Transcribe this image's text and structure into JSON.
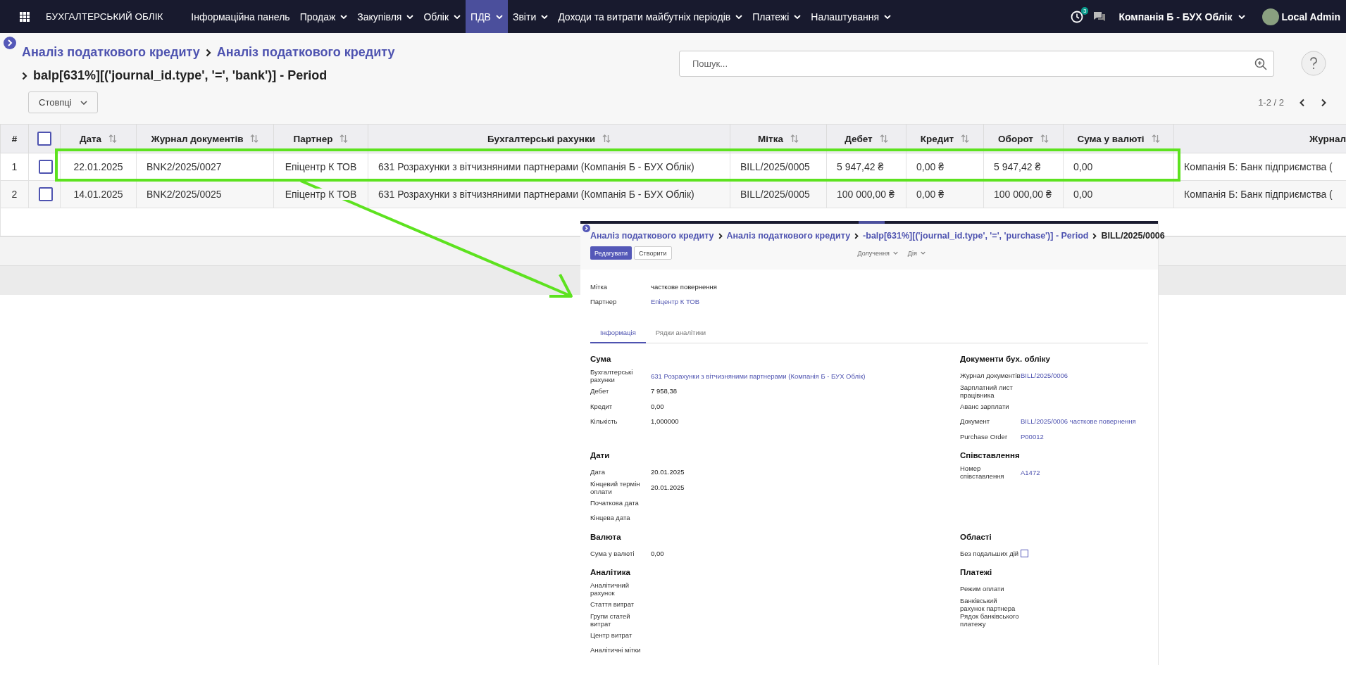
{
  "navbar": {
    "app_name": "БУХГАЛТЕРСЬКИЙ ОБЛІК",
    "menu": [
      {
        "label": "Інформаційна панель",
        "dropdown": false,
        "selected": false
      },
      {
        "label": "Продаж",
        "dropdown": true,
        "selected": false
      },
      {
        "label": "Закупівля",
        "dropdown": true,
        "selected": false
      },
      {
        "label": "Облік",
        "dropdown": true,
        "selected": false
      },
      {
        "label": "ПДВ",
        "dropdown": true,
        "selected": true
      },
      {
        "label": "Звіти",
        "dropdown": true,
        "selected": false
      },
      {
        "label": "Доходи та витрати майбутніх періодів",
        "dropdown": true,
        "selected": false
      },
      {
        "label": "Платежі",
        "dropdown": true,
        "selected": false
      },
      {
        "label": "Налаштування",
        "dropdown": true,
        "selected": false
      }
    ],
    "activity_count": "3",
    "company": "Компанія Б - БУХ Облік",
    "user": "Local Admin"
  },
  "breadcrumbs": [
    {
      "label": "Аналіз податкового кредиту",
      "link": true
    },
    {
      "label": "Аналіз податкового кредиту",
      "link": true
    },
    {
      "label": "balp[631%][('journal_id.type', '=', 'bank')] - Period",
      "link": false
    }
  ],
  "search": {
    "placeholder": "Пошук..."
  },
  "columns_button": "Стовпці",
  "pager": "1-2 / 2",
  "table": {
    "number_header": "#",
    "select_all": {
      "checked": false
    },
    "columns": [
      {
        "label": "Дата",
        "sortable": true
      },
      {
        "label": "Журнал документів",
        "sortable": true
      },
      {
        "label": "Партнер",
        "sortable": true
      },
      {
        "label": "Бухгалтерські рахунки",
        "sortable": true
      },
      {
        "label": "Мітка",
        "sortable": true
      },
      {
        "label": "Дебет",
        "sortable": true
      },
      {
        "label": "Кредит",
        "sortable": true
      },
      {
        "label": "Оборот",
        "sortable": true
      },
      {
        "label": "Сума у валюті",
        "sortable": true
      },
      {
        "label": "Журнал",
        "sortable": false
      }
    ],
    "rows": [
      {
        "number": "1",
        "checked": false,
        "cells": [
          "22.01.2025",
          "BNK2/2025/0027",
          "Епіцентр К ТОВ",
          "631 Розрахунки з вітчизняними партнерами (Компанія Б - БУХ Облік)",
          "BILL/2025/0005",
          "5 947,42 ₴",
          "0,00 ₴",
          "5 947,42 ₴",
          "0,00",
          "Компанія Б: Банк підприємства ("
        ]
      },
      {
        "number": "2",
        "checked": false,
        "cells": [
          "14.01.2025",
          "BNK2/2025/0025",
          "Епіцентр К ТОВ",
          "631 Розрахунки з вітчизняними партнерами (Компанія Б - БУХ Облік)",
          "BILL/2025/0005",
          "100 000,00 ₴",
          "0,00 ₴",
          "100 000,00 ₴",
          "0,00",
          "Компанія Б: Банк підприємства ("
        ]
      }
    ]
  },
  "annotation": {
    "frame": true,
    "arrow": true
  },
  "detail_window": {
    "breadcrumbs": [
      {
        "label": "Аналіз податкового кредиту",
        "link": true
      },
      {
        "label": "Аналіз податкового кредиту",
        "link": true
      },
      {
        "label": "-balp[631%][('journal_id.type', '=', 'purchase')] - Period",
        "link": true
      },
      {
        "label": "BILL/2025/0006",
        "link": false
      }
    ],
    "buttons": [
      {
        "label": "Редагувати",
        "kind": "primary"
      },
      {
        "label": "Створити",
        "kind": "secondary"
      }
    ],
    "menus": [
      "Долучення",
      "Дія"
    ],
    "header_fields": [
      {
        "label": "Мітка",
        "value": "часткове повернення",
        "kind": "text"
      },
      {
        "label": "Партнер",
        "value": "Епіцентр К ТОВ",
        "kind": "link"
      }
    ],
    "tabs": [
      {
        "label": "Інформація",
        "selected": true
      },
      {
        "label": "Рядки аналітики",
        "selected": false
      }
    ],
    "section_rows": [
      {
        "left": {
          "title": "Сума",
          "fields": [
            {
              "label": "Бухгалтерські рахунки",
              "value": "631 Розрахунки з вітчизняними партнерами (Компанія Б - БУХ Облік)",
              "kind": "link"
            },
            {
              "label": "Дебет",
              "value": "7 958,38",
              "kind": "text"
            },
            {
              "label": "Кредит",
              "value": "0,00",
              "kind": "text"
            },
            {
              "label": "Кількість",
              "value": "1,000000",
              "kind": "text"
            }
          ]
        },
        "right": {
          "title": "Документи бух. обліку",
          "fields": [
            {
              "label": "Журнал документів",
              "value": "BILL/2025/0006",
              "kind": "link"
            },
            {
              "label": "Зарплатний лист працівника",
              "kind": "text"
            },
            {
              "label": "Аванс зарплати",
              "kind": "text"
            },
            {
              "label": "Документ",
              "value": "BILL/2025/0006 часткове повернення",
              "kind": "link"
            },
            {
              "label": "Purchase Order",
              "value": "P00012",
              "kind": "link"
            }
          ]
        }
      },
      {
        "left": {
          "title": "Дати",
          "fields": [
            {
              "label": "Дата",
              "value": "20.01.2025",
              "kind": "text"
            },
            {
              "label": "Кінцевий термін оплати",
              "value": "20.01.2025",
              "kind": "text"
            },
            {
              "label": "Початкова дата",
              "kind": "text"
            },
            {
              "label": "Кінцева дата",
              "kind": "text"
            }
          ]
        },
        "right": {
          "title": "Співставлення",
          "fields": [
            {
              "label": "Номер співставлення",
              "value": "A1472",
              "kind": "link"
            }
          ]
        }
      },
      {
        "left": {
          "title": "Валюта",
          "fields": [
            {
              "label": "Сума у валюті",
              "value": "0,00",
              "kind": "text"
            }
          ]
        },
        "right": {
          "title": "Області",
          "fields": [
            {
              "label": "Без подальших дій",
              "kind": "checkbox",
              "checked": false
            }
          ]
        }
      },
      {
        "left": {
          "title": "Аналітика",
          "fields": [
            {
              "label": "Аналітичний рахунок",
              "kind": "text"
            },
            {
              "label": "Стаття витрат",
              "kind": "text"
            },
            {
              "label": "Групи статей витрат",
              "kind": "text"
            },
            {
              "label": "Центр витрат",
              "kind": "text"
            },
            {
              "label": "Аналітичні мітки",
              "kind": "text"
            }
          ]
        },
        "right": {
          "title": "Платежі",
          "fields": [
            {
              "label": "Режим оплати",
              "kind": "text"
            },
            {
              "label": "Банківський рахунок партнера",
              "kind": "text"
            },
            {
              "label": "Рядок банківського платежу",
              "kind": "text"
            }
          ]
        }
      }
    ]
  }
}
